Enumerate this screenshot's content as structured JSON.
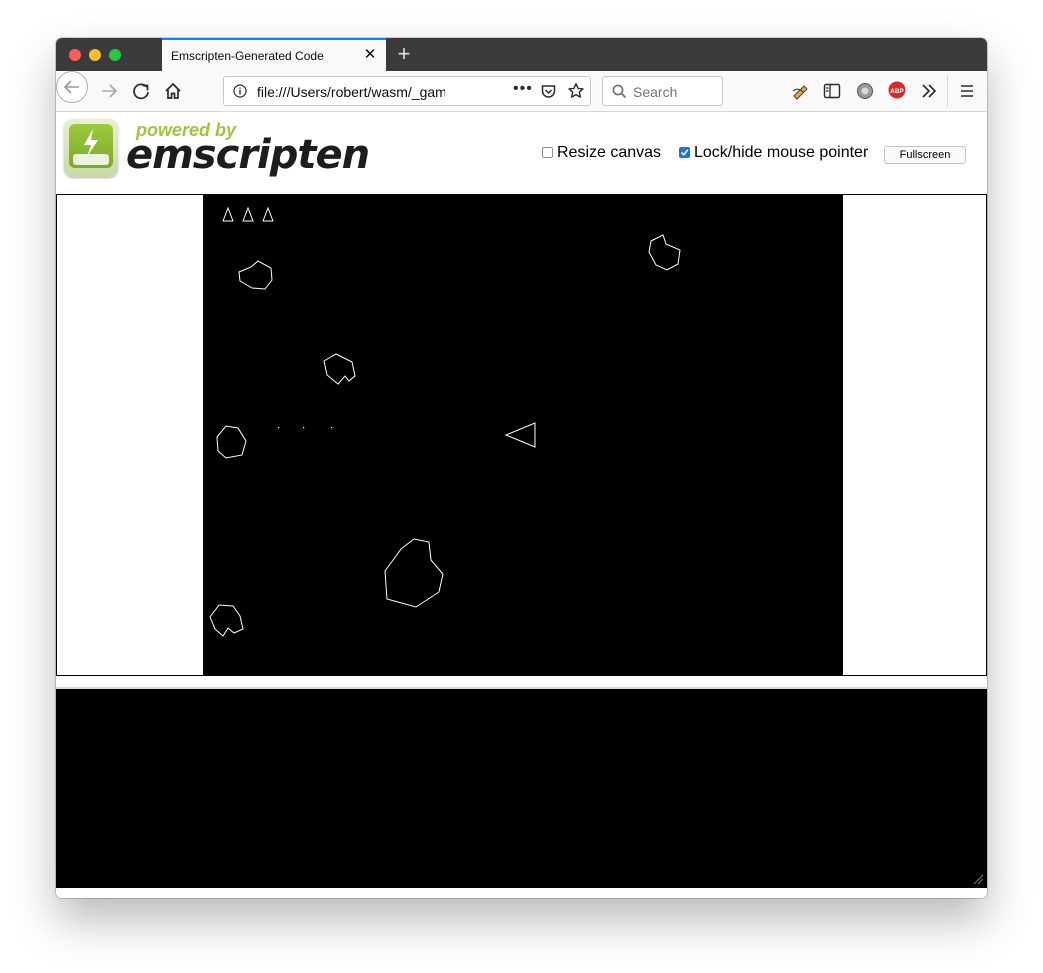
{
  "browser": {
    "tab_title": "Emscripten-Generated Code",
    "url": "file:///Users/robert/wasm/_games/a",
    "search_placeholder": "Search"
  },
  "page": {
    "logo": {
      "powered_by": "powered by",
      "name": "emscripten"
    },
    "controls": {
      "resize_canvas": {
        "label": "Resize canvas",
        "checked": false
      },
      "lock_pointer": {
        "label": "Lock/hide mouse pointer",
        "checked": true
      },
      "fullscreen_label": "Fullscreen"
    }
  },
  "game": {
    "lives": 3,
    "colors": {
      "background": "#000000",
      "stroke": "#ffffff"
    }
  }
}
